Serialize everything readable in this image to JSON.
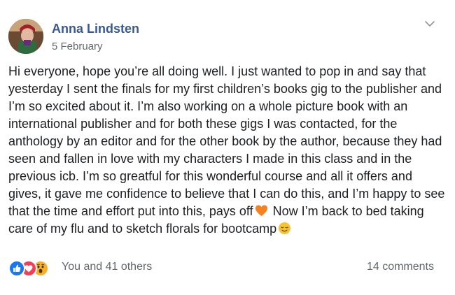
{
  "post": {
    "author": "Anna Lindsten",
    "date": "5 February",
    "text_part1": "Hi everyone, hope you’re all doing well. I just wanted to pop in and say that yesterday I sent the finals for my first children’s books gig to the publisher and I’m so excited about it. I’m also working on a whole picture book with an international publisher and for both these gigs I was contacted, for the anthology by an editor and for the other book by the author, because they had seen and fallen in love with my characters I made in this class and in the previous icb. I’m so greatful for this wonderful course and all it offers and gives, it gave me confidence to believe that I can do this, and I’m happy to see that the time and effort put into this, pays off",
    "text_part2": " Now I’m back to bed taking care of my flu and to sketch florals for bootcamp",
    "inline_emojis": [
      "orange-heart-emoji",
      "relieved-face-emoji"
    ]
  },
  "icons": {
    "menu": "chevron-down-icon",
    "reactions": [
      "like-icon",
      "love-icon",
      "wow-icon"
    ]
  },
  "footer": {
    "reactions_text": "You and 41 others",
    "comments_text": "14 comments"
  },
  "colors": {
    "author_link": "#385898",
    "secondary_text": "#606770",
    "like": "#1877f2",
    "love": "#f33e58",
    "wow": "#f7b125",
    "orange_heart": "#f5821f"
  }
}
